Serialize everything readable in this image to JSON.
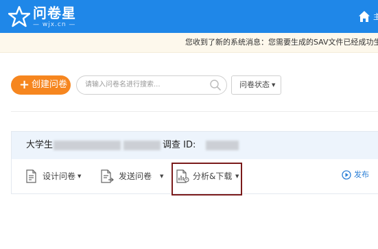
{
  "brand": {
    "name": "问卷星",
    "subtitle": "— wjx.cn —"
  },
  "header": {
    "edge_text": "主"
  },
  "notice": {
    "text": "您收到了新的系统消息：您需要生成的SAV文件已经成功生成"
  },
  "toolbar": {
    "create_label": "创建问卷",
    "search_placeholder": "请输入问卷名进行搜索...",
    "status_label": "问卷状态"
  },
  "survey": {
    "title_prefix": "大学生",
    "title_suffix": "调查  ID:",
    "actions": {
      "design": "设计问卷",
      "send": "发送问卷",
      "analyze": "分析&下载",
      "publish": "发布"
    }
  },
  "colors": {
    "header_bg": "#1f87e8",
    "accent_orange": "#f6861f",
    "notice_bg": "#fdf8ec",
    "card_head_bg": "#edf4fc",
    "highlight_border": "#7a1a1a",
    "link_blue": "#2b7fd6"
  }
}
